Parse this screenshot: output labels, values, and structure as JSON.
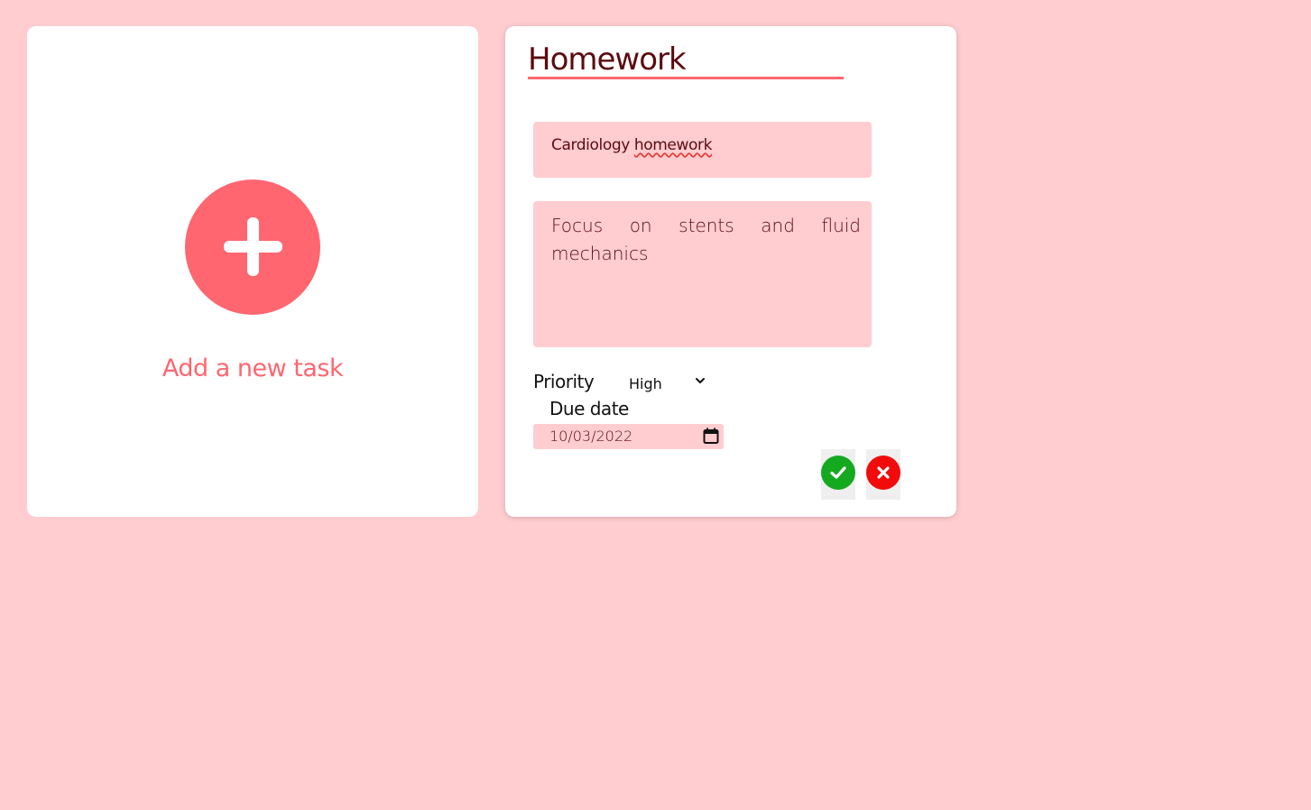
{
  "add_card": {
    "label": "Add a new task",
    "icon": "plus-icon",
    "accent_color": "#ff6670"
  },
  "task_form": {
    "title": "Homework",
    "subtitle_parts": [
      "Cardiology ",
      "homework"
    ],
    "description": "Focus on stents and fluid mechanics",
    "priority_label": "Priority",
    "priority_value": "High",
    "due_date_label": "Due date",
    "due_date_value": "10/03/2022",
    "confirm_icon": "checkmark-icon",
    "cancel_icon": "close-icon"
  },
  "colors": {
    "background": "#ffcdd0",
    "card": "#ffffff",
    "text_dark": "#5c0a10",
    "confirm": "#15a920",
    "cancel": "#f20b0b"
  }
}
